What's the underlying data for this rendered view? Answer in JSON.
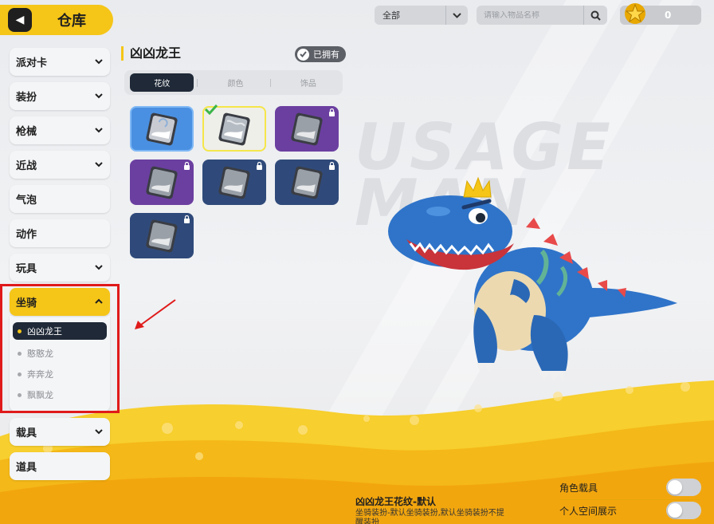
{
  "header": {
    "back_icon": "back-arrow-icon",
    "title": "仓库",
    "filter": {
      "selected": "全部"
    },
    "search": {
      "placeholder": "请输入物品名称"
    },
    "currency": {
      "icon": "star-coin-icon",
      "value": "0"
    }
  },
  "sidebar": {
    "items": [
      {
        "label": "派对卡",
        "has_dropdown": true
      },
      {
        "label": "装扮",
        "has_dropdown": true
      },
      {
        "label": "枪械",
        "has_dropdown": true
      },
      {
        "label": "近战",
        "has_dropdown": true
      },
      {
        "label": "气泡",
        "has_dropdown": false
      },
      {
        "label": "动作",
        "has_dropdown": false
      },
      {
        "label": "玩具",
        "has_dropdown": true
      },
      {
        "label": "坐骑",
        "has_dropdown": true,
        "expanded": true
      },
      {
        "label": "载具",
        "has_dropdown": true
      },
      {
        "label": "道具",
        "has_dropdown": false
      }
    ],
    "mount_subitems": [
      {
        "label": "凶凶龙王",
        "selected": true
      },
      {
        "label": "憨憨龙",
        "selected": false
      },
      {
        "label": "奔奔龙",
        "selected": false
      },
      {
        "label": "飘飘龙",
        "selected": false
      }
    ]
  },
  "detail": {
    "name": "凶凶龙王",
    "owned_label": "已拥有",
    "tabs": [
      {
        "label": "花纹",
        "active": true
      },
      {
        "label": "颜色",
        "active": false
      },
      {
        "label": "饰品",
        "active": false
      }
    ],
    "skins": [
      {
        "color": "#4a90e2",
        "locked": false,
        "equipped": false
      },
      {
        "color": "#efefe9",
        "locked": false,
        "equipped": true
      },
      {
        "color": "#6b3fa0",
        "locked": true,
        "equipped": false
      },
      {
        "color": "#6b3fa0",
        "locked": true,
        "equipped": false
      },
      {
        "color": "#2f4a7a",
        "locked": true,
        "equipped": false
      },
      {
        "color": "#2f4a7a",
        "locked": true,
        "equipped": false
      },
      {
        "color": "#2f4a7a",
        "locked": true,
        "equipped": false
      }
    ]
  },
  "info": {
    "skin_title": "凶凶龙王花纹-默认",
    "skin_desc": "坐骑装扮-默认坐骑装扮,默认坐骑装扮不提醒装扮",
    "toggles": [
      {
        "label": "角色载具",
        "on": false
      },
      {
        "label": "个人空间展示",
        "on": false
      }
    ]
  },
  "background_text": "USAGE MAN",
  "colors": {
    "accent_yellow": "#f5c518",
    "dark_navy": "#1f2937",
    "annotation_red": "#e01a1a",
    "dino_blue": "#2f74c9"
  }
}
